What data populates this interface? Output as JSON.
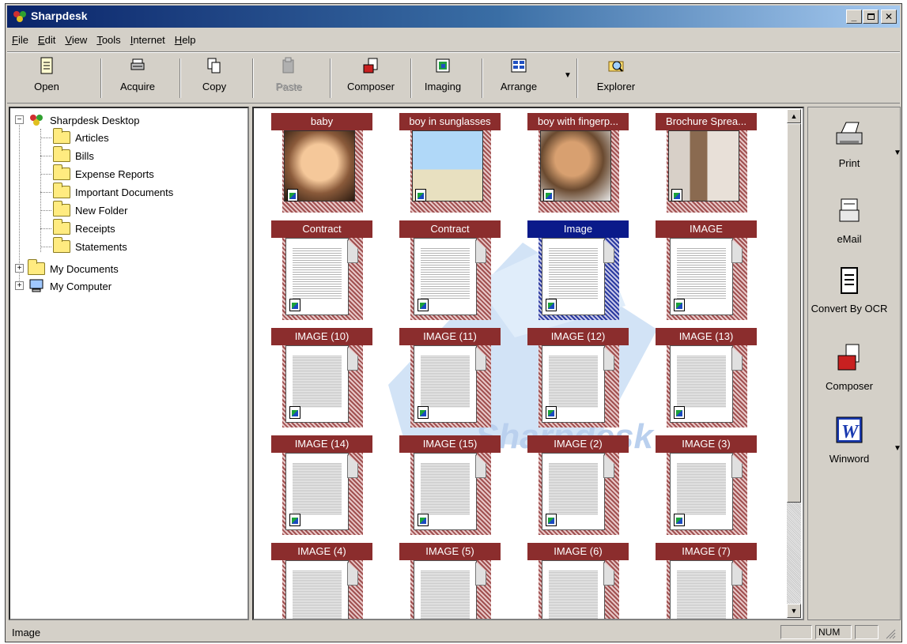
{
  "window": {
    "title": "Sharpdesk"
  },
  "menu": [
    {
      "label": "File",
      "mnemonic": "F"
    },
    {
      "label": "Edit",
      "mnemonic": "E"
    },
    {
      "label": "View",
      "mnemonic": "V"
    },
    {
      "label": "Tools",
      "mnemonic": "T"
    },
    {
      "label": "Internet",
      "mnemonic": "I"
    },
    {
      "label": "Help",
      "mnemonic": "H"
    }
  ],
  "toolbar": {
    "open": "Open",
    "acquire": "Acquire",
    "copy": "Copy",
    "paste": "Paste",
    "composer": "Composer",
    "imaging": "Imaging",
    "arrange": "Arrange",
    "explorer": "Explorer"
  },
  "tree": {
    "root": "Sharpdesk Desktop",
    "folders": [
      "Articles",
      "Bills",
      "Expense Reports",
      "Important Documents",
      "New Folder",
      "Receipts",
      "Statements"
    ],
    "my_documents": "My Documents",
    "my_computer": "My Computer"
  },
  "thumbnails": [
    {
      "label": "baby",
      "kind": "photo"
    },
    {
      "label": "boy in sunglasses",
      "kind": "photo"
    },
    {
      "label": "boy with fingerp...",
      "kind": "photo"
    },
    {
      "label": "Brochure Sprea...",
      "kind": "photo"
    },
    {
      "label": "Contract",
      "kind": "doc"
    },
    {
      "label": "Contract",
      "kind": "doc"
    },
    {
      "label": "Image",
      "kind": "doc",
      "selected": true
    },
    {
      "label": "IMAGE",
      "kind": "doc"
    },
    {
      "label": "IMAGE (10)",
      "kind": "doc"
    },
    {
      "label": "IMAGE (11)",
      "kind": "doc"
    },
    {
      "label": "IMAGE (12)",
      "kind": "doc"
    },
    {
      "label": "IMAGE (13)",
      "kind": "doc"
    },
    {
      "label": "IMAGE (14)",
      "kind": "doc"
    },
    {
      "label": "IMAGE (15)",
      "kind": "doc"
    },
    {
      "label": "IMAGE (2)",
      "kind": "doc"
    },
    {
      "label": "IMAGE (3)",
      "kind": "doc"
    },
    {
      "label": "IMAGE (4)",
      "kind": "doc"
    },
    {
      "label": "IMAGE (5)",
      "kind": "doc"
    },
    {
      "label": "IMAGE (6)",
      "kind": "doc"
    },
    {
      "label": "IMAGE (7)",
      "kind": "doc"
    }
  ],
  "watermark": "Sharpdesk",
  "right_panel": {
    "print": "Print",
    "email": "eMail",
    "ocr": "Convert By OCR",
    "composer": "Composer",
    "winword": "Winword"
  },
  "status": {
    "text": "Image",
    "num": "NUM"
  },
  "colors": {
    "label_bg": "#8b2d2d",
    "selected_bg": "#0a1a8a",
    "titlebar": "#0a246a"
  }
}
